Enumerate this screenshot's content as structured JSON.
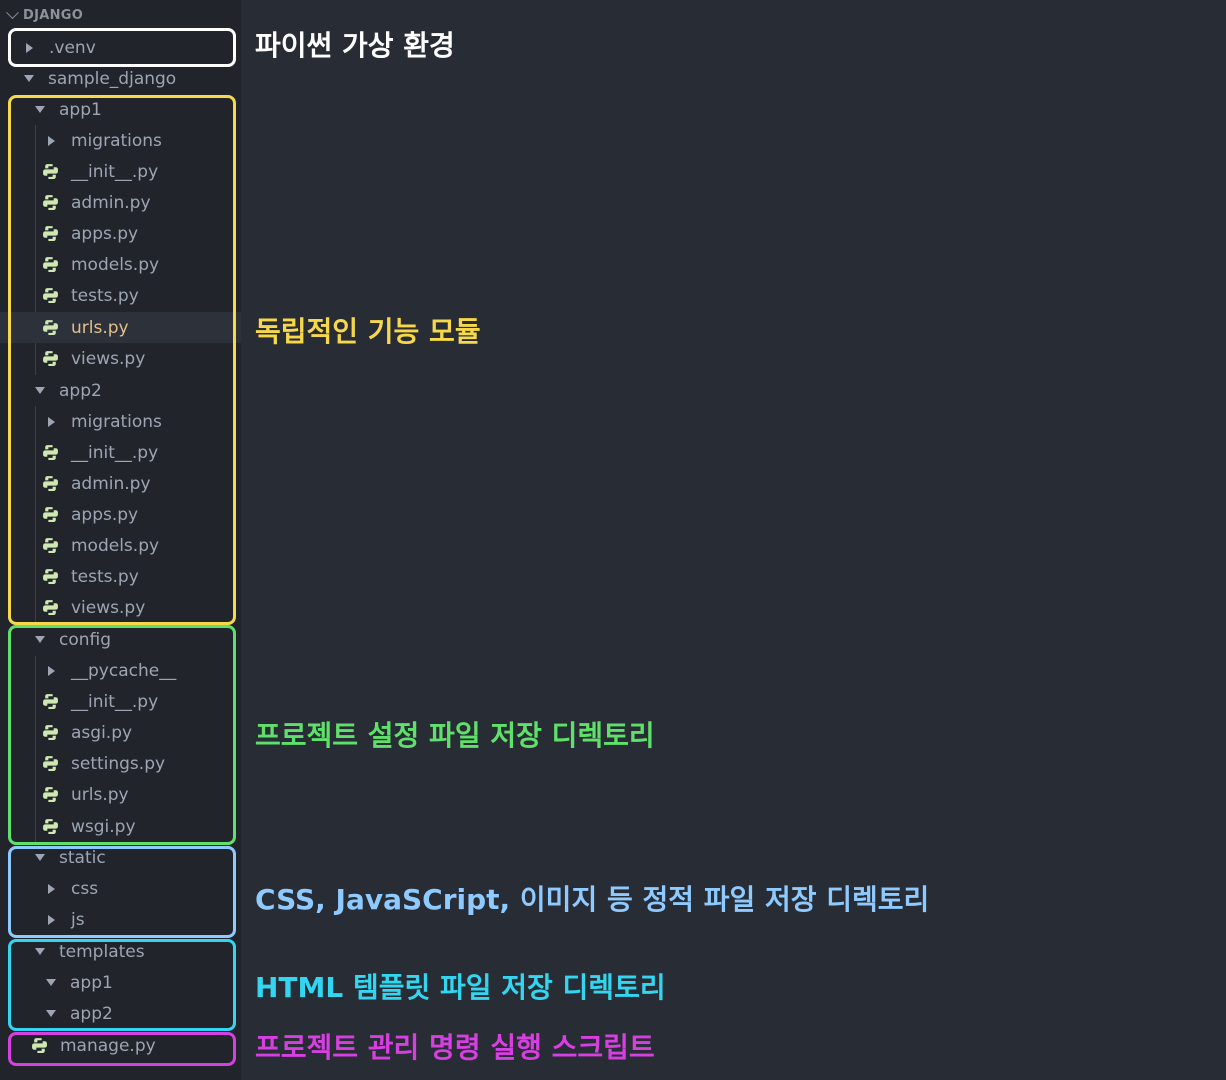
{
  "explorer": {
    "section_title": "DJANGO",
    "items": {
      "venv": ".venv",
      "sample_django": "sample_django",
      "app1": "app1",
      "app1_migrations": "migrations",
      "app1_init": "__init__.py",
      "app1_admin": "admin.py",
      "app1_apps": "apps.py",
      "app1_models": "models.py",
      "app1_tests": "tests.py",
      "app1_urls": "urls.py",
      "app1_views": "views.py",
      "app2": "app2",
      "app2_migrations": "migrations",
      "app2_init": "__init__.py",
      "app2_admin": "admin.py",
      "app2_apps": "apps.py",
      "app2_models": "models.py",
      "app2_tests": "tests.py",
      "app2_views": "views.py",
      "config": "config",
      "config_pycache": "__pycache__",
      "config_init": "__init__.py",
      "config_asgi": "asgi.py",
      "config_settings": "settings.py",
      "config_urls": "urls.py",
      "config_wsgi": "wsgi.py",
      "static": "static",
      "static_css": "css",
      "static_js": "js",
      "templates": "templates",
      "templates_app1": "app1",
      "templates_app2": "app2",
      "manage": "manage.py"
    }
  },
  "annotations": {
    "venv": "파이썬 가상 환경",
    "apps": "독립적인 기능 모듈",
    "config": "프로젝트 설정 파일 저장 디렉토리",
    "static": "CSS, JavaSCript, 이미지 등 정적 파일 저장 디렉토리",
    "templates": "HTML 템플릿 파일 저장 디렉토리",
    "manage": "프로젝트 관리 명령 실행 스크립트"
  },
  "colors": {
    "venv": "#ffffff",
    "apps": "#f6d84a",
    "config": "#5fe06a",
    "static": "#8ec9ff",
    "templates": "#33d6f0",
    "manage": "#d63fe0"
  }
}
